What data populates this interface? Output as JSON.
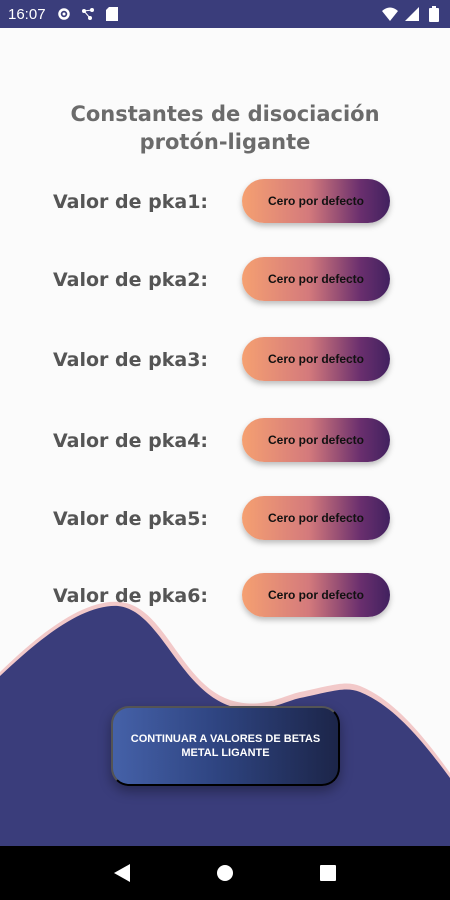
{
  "status_bar": {
    "time": "16:07",
    "left_icons": [
      "gear-icon",
      "share-icon",
      "sd-card-icon"
    ],
    "right_icons": [
      "wifi-icon",
      "signal-icon",
      "battery-icon"
    ],
    "bg_color": "#3a3d7b"
  },
  "header": {
    "title_line1": "Constantes de disociación",
    "title_line2": "protón-ligante"
  },
  "rows": [
    {
      "label": "Valor de pka1:",
      "button": "Cero por defecto"
    },
    {
      "label": "Valor de pka2:",
      "button": "Cero por defecto"
    },
    {
      "label": "Valor de pka3:",
      "button": "Cero por defecto"
    },
    {
      "label": "Valor de pka4:",
      "button": "Cero por defecto"
    },
    {
      "label": "Valor de pka5:",
      "button": "Cero por defecto"
    },
    {
      "label": "Valor de pka6:",
      "button": "Cero por defecto"
    }
  ],
  "continue_button": {
    "label_line1": "CONTINUAR A VALORES DE BETAS",
    "label_line2": "METAL LIGANTE"
  },
  "nav_bar": {
    "icons": [
      "back-icon",
      "home-icon",
      "recents-icon"
    ]
  },
  "colors": {
    "wave": "#3a3d7b",
    "wave_accent": "#f2c9c9",
    "button_gradient_start": "#f5a071",
    "button_gradient_end": "#41215f"
  }
}
